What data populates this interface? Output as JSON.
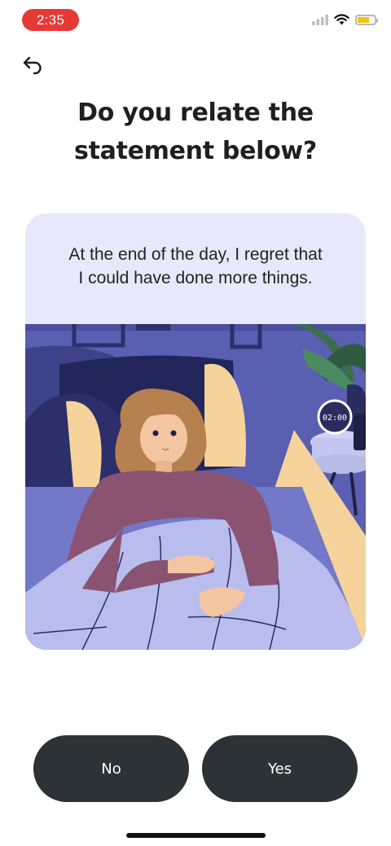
{
  "status_bar": {
    "time": "2:35",
    "time_pill_color": "#e53935",
    "icons": [
      "cellular-signal-icon",
      "wifi-icon",
      "battery-icon"
    ],
    "battery_level": 0.68,
    "battery_color": "#f1c40f"
  },
  "header": {
    "back_icon": "back-arrow-icon",
    "title": "Do you relate the\nstatement below?"
  },
  "card": {
    "statement": "At the end of the day, I regret that\nI could have done more things.",
    "background": "#e7e8fb",
    "illustration": {
      "description_icon": "woman-in-bed-illustration",
      "clock_text": "02:00"
    }
  },
  "actions": {
    "no_label": "No",
    "yes_label": "Yes",
    "button_color": "#2c3236"
  }
}
